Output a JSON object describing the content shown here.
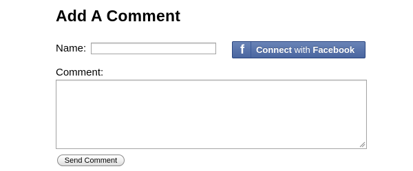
{
  "form": {
    "title": "Add A Comment",
    "name_label": "Name:",
    "name_value": "",
    "facebook_button": {
      "icon": "facebook-f-icon",
      "text_connect": "Connect",
      "text_with": "with",
      "text_brand": "Facebook",
      "color": "#5974ab"
    },
    "comment_label": "Comment:",
    "comment_value": "",
    "send_label": "Send Comment"
  }
}
